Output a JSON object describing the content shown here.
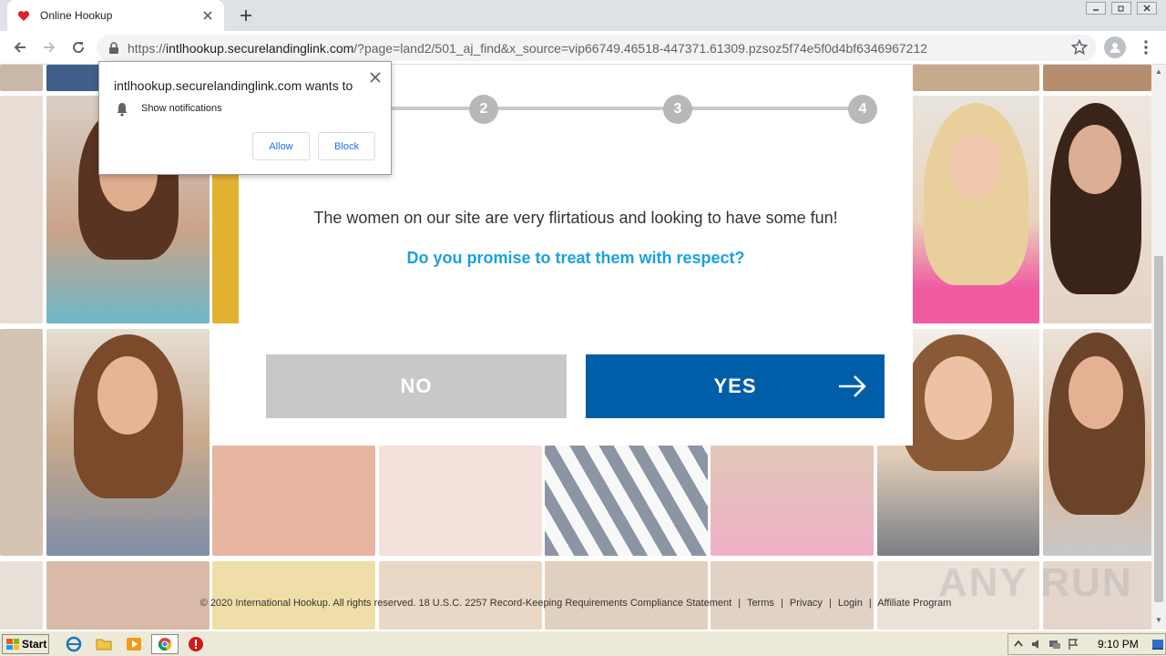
{
  "browser": {
    "tab_title": "Online Hookup",
    "url_scheme": "https://",
    "url_host": "intlhookup.securelandinglink.com",
    "url_path": "/?page=land2/501_aj_find&x_source=vip66749.46518-447371.61309.pzsoz5f74e5f0d4bf6346967212"
  },
  "notification": {
    "title": "intlhookup.securelandinglink.com wants to",
    "permission": "Show notifications",
    "allow_label": "Allow",
    "block_label": "Block"
  },
  "modal": {
    "steps": [
      "2",
      "3",
      "4"
    ],
    "message": "The women on our site are very flirtatious and looking to have some fun!",
    "question": "Do you promise to treat them with respect?",
    "no_label": "NO",
    "yes_label": "YES"
  },
  "footer": {
    "copyright": "© 2020 International Hookup. All rights reserved.",
    "compliance": "18 U.S.C. 2257 Record-Keeping Requirements Compliance Statement",
    "terms": "Terms",
    "privacy": "Privacy",
    "login": "Login",
    "affiliate": "Affiliate Program",
    "sep1": "|",
    "sep2": "|",
    "sep3": "|",
    "sep4": "|"
  },
  "watermark": "ANY RUN",
  "taskbar": {
    "start_label": "Start",
    "clock": "9:10 PM"
  },
  "colors": {
    "accent_blue": "#005ea8",
    "question_blue": "#1aa1e0",
    "no_gray": "#c8c8c8"
  }
}
